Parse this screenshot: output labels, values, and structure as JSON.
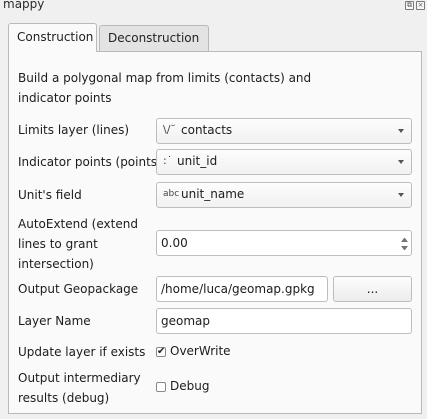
{
  "window": {
    "title": "mappy"
  },
  "tabs": [
    {
      "label": "Construction",
      "active": true
    },
    {
      "label": "Deconstruction",
      "active": false
    }
  ],
  "form": {
    "description": "Build a polygonal map from limits (contacts) and indicator points",
    "limits_layer": {
      "label": "Limits layer (lines)",
      "value": "contacts",
      "icon": "line-layer-icon"
    },
    "indicator_points": {
      "label": "Indicator points (points)",
      "value": "unit_id",
      "icon": "point-layer-icon"
    },
    "units_field": {
      "label": "Unit's field",
      "value": "unit_name",
      "icon": "text-field-icon"
    },
    "auto_extend": {
      "label": "AutoExtend (extend lines to grant intersection)",
      "value": "0.00"
    },
    "output_geopackage": {
      "label": "Output Geopackage",
      "value": "/home/luca/geomap.gpkg",
      "browse_label": "..."
    },
    "layer_name": {
      "label": "Layer Name",
      "value": "geomap"
    },
    "update_layer": {
      "label": "Update layer if exists",
      "checkbox_label": "OverWrite",
      "checked": true
    },
    "output_intermediary": {
      "label": "Output intermediary results (debug)",
      "checkbox_label": "Debug",
      "checked": false
    }
  }
}
